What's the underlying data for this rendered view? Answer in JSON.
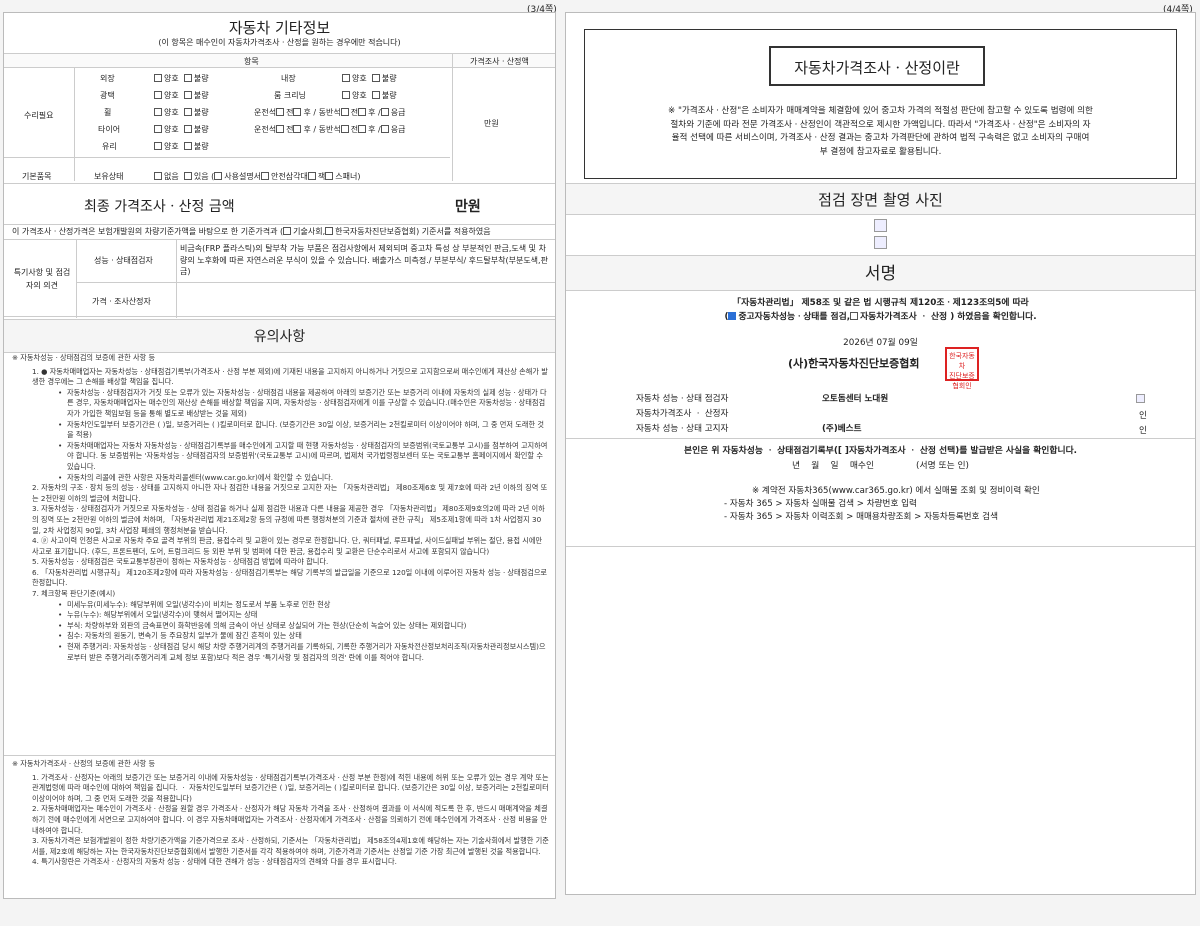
{
  "pages": {
    "left": "(3/4쪽)",
    "right": "(4/4쪽)"
  },
  "etc": {
    "title": "자동차 기타정보",
    "subtitle": "(이 항목은 매수인이 자동차가격조사ㆍ산정을 원하는 경우에만 적습니다)",
    "col_item": "항목",
    "col_price": "가격조사ㆍ산정액",
    "repair_label": "수리필요",
    "basic_label": "기본품목",
    "price_value": "만원",
    "opt_good": "양호",
    "opt_bad": "불량",
    "opt_none": "없음",
    "opt_have": "있음",
    "items": {
      "exterior": "외장",
      "interior": "내장",
      "gloss": "광택",
      "room": "룸 크리닝",
      "wheel": "휠",
      "tire": "타이어",
      "glass": "유리",
      "tool": "보유상태"
    },
    "driver": "운전석",
    "passenger": "동반석",
    "front": "전",
    "rear": "후",
    "spare": "응급",
    "basic_opts": {
      "manual": "사용설명서",
      "triangle": "안전삼각대",
      "jack": "잭",
      "spanner": "스패너"
    }
  },
  "final": {
    "label": "최종 가격조사ㆍ산정 금액",
    "unit": "만원",
    "note": "이 가격조사ㆍ산정가격은 보험개발원의 차량기준가액을 바탕으로 한 기준가격과 (",
    "opt1": "기술사회,",
    "opt2": "한국자동차진단보증협회) 기준서를 적용하였음"
  },
  "special": {
    "label": "특기사항 및 점검자의 의견",
    "inspector_label": "성능ㆍ상태점검자",
    "inspector_text": "비금속(FRP 플라스틱)의 탈부착 가능 부품은 점검사항에서 제외되며 중고차 특성 상 부분적인 판금,도색 및 차량의 노후화에 따른 자연스러운 부식이 있을 수 있습니다. 배출가스 미측정./ 부분부식/ 후드탈부착(부분도색,판금)",
    "appraiser_label": "가격ㆍ조사산정자"
  },
  "notes": {
    "title": "유의사항",
    "h1": "※ 자동차성능ㆍ상태점검의 보증에 관한 사항 등",
    "a1": "1.       ● 자동차매매업자는 자동차성능ㆍ상태점검기록부(가격조사ㆍ산정 부분 제외)에 기재된 내용을 고지하지 아니하거나 거짓으로 고지함으로써 매수인에게 재산상 손해가 발생한 경우에는 그 손해를 배상할 책임을 집니다.",
    "a2": "자동차성능ㆍ상태점검자가 거짓 또는 오류가 있는 자동차성능ㆍ상태점검 내용을 제공하여 아래의 보증기간 또는 보증거리 이내에 자동차의 실제 성능ㆍ상태가 다른 경우, 자동차매매업자는 매수인의 재산상 손해를 배상할 책임을 지며, 자동차성능ㆍ상태점검자에게 이를 구상할 수 있습니다.(매수인은 자동차성능ㆍ상태점검자가 가입한 책임보험 등을 통해 별도로 배상받는 것을 제외)",
    "a3": "자동차인도일부터 보증기간은 (        )일, 보증거리는 (        )킬로미터로 합니다. (보증기간은 30일 이상, 보증거리는 2천킬로미터 이상이어야 하며, 그 중 먼저 도래한 것을 적용)",
    "a4": "자동차매매업자는 자동차 자동차성능ㆍ상태점검기록부를 매수인에게 고지할 때 현행 자동차성능ㆍ상태점검자의 보증범위(국토교통부 고시)를 첨부하여 고지하여야 합니다. 동 보증범위는 '자동차성능ㆍ상태점검자의 보증범위'(국토교통부 고시)에 따르며, 법제처 국가법령정보센터 또는 국토교통부 홈페이지에서 확인할 수 있습니다.",
    "a5": "자동차의 리콜에 관한 사항은 자동차리콜센터(www.car.go.kr)에서 확인할 수 있습니다.",
    "n2": "2. 자동차의 구조ㆍ장치 등의 성능ㆍ상태를 고지하지 아니한 자나 점검한 내용을 거짓으로 고지한 자는 「자동차관리법」 제80조제6호 및 제7호에 따라 2년 이하의 징역 또는 2천만원 이하의 벌금에 처합니다.",
    "n3": "3. 자동차성능ㆍ상태점검자가 거짓으로 자동차성능ㆍ상태 점검을 하거나 실제 점검한 내용과 다른 내용을 제공한 경우 「자동차관리법」 제80조제9호의2에 따라 2년 이하의 징역 또는 2천만원 이하의 벌금에 처하며, 「자동차관리법 제21조제2항 등의 규정에 따른 행정처분의 기준과 절차에 관한 규칙」 제5조제1항에 따라 1차 사업정지 30일, 2차 사업정지 90일, 3차 사업장 폐쇄의 행정처분을 받습니다.",
    "n4": "4. ⓟ 사고이력 인정은 사고로 자동차 주요 골격 부위의 판금, 용접수리 및 교환이 있는 경우로 한정합니다. 단, 쿼터패널, 루프패널, 사이드실패널 부위는 절단, 용접 시에만 사고로 표기합니다. (후드, 프론트펜더, 도어, 트렁크리드 등 외판 부위 및 범퍼에 대한 판금, 용접수리 및 교환은 단순수리로서 사고에 포함되지 않습니다)",
    "n5": "5. 자동차성능ㆍ상태점검은 국토교통부장관이 정하는 자동차성능ㆍ상태점검 방법에 따라야 합니다.",
    "n6": "6. 「자동차관리법 시행규칙」 제120조제2항에 따라 자동차성능ㆍ상태점검기록부는 해당 기록부의 발급일을 기준으로 120일 이내에 이루어진 자동차 성능ㆍ상태점검으로 한정합니다.",
    "n7": "7. 체크항목 판단기준(예시)",
    "c1": "미세누유(미세누수): 해당부위에 오일(냉각수)이 비치는 정도로서 부품 노후로 인한 현상",
    "c2": "누유(누수): 해당부위에서 오일(냉각수)이 맺혀서 떨어지는 상태",
    "c3": "부식: 차량하부와 외판의 금속표면이 화학반응에 의해 금속이 아닌 상태로 상실되어 가는 현상(단순히 녹슬어 있는 상태는 제외합니다)",
    "c4": "침수: 자동차의 원동기, 변속기 등 주요장치 일부가 물에 잠긴 흔적이 있는 상태",
    "c5": "현재 주행거리: 자동차성능ㆍ상태점검 당시 해당 차량 주행거리계의 주행거리를 기록하되, 기록한 주행거리가 자동차전산정보처리조직(자동차관리정보시스템)으로부터 받은 주행거리(주행거리계 교체 정보 포함)보다 적은 경우 '특기사항 및 점검자의 의견' 란에 이를 적어야 합니다.",
    "h2": "※ 자동차가격조사ㆍ산정의 보증에 관한 사항 등",
    "p1": "1. 가격조사ㆍ산정자는 아래의 보증기간 또는 보증거리 이내에 자동차성능ㆍ상태점검기록부(가격조사ㆍ산정 부분 한정)에 적힌 내용에 허위 또는 오류가 있는 경우 계약 또는 관계법령에 따라 매수인에 대하여 책임을 집니다.   ㆍ 자동차인도일부터 보증기간은 (      )일, 보증거리는 (      )킬로미터로 합니다. (보증기간은 30일 이상, 보증거리는 2천킬로미터 이상이어야 하며, 그 중 먼저 도래한 것을 적용합니다)",
    "p2": "2. 자동차매매업자는 매수인이 가격조사ㆍ산정을 원할 경우 가격조사ㆍ산정자가 해당 자동차 가격을 조사ㆍ산정하여 결과를 이 서식에 적도록 한 후, 반드시 매매계약을 체결하기 전에 매수인에게 서면으로 고지하여야 합니다. 이 경우 자동차매매업자는 가격조사ㆍ산정자에게 가격조사ㆍ산정을 의뢰하기 전에 매수인에게 가격조사ㆍ산정 비용을 안내하여야 합니다.",
    "p3": "3. 자동차가격은 보험개발원이 정한 차량기준가액을 기준가격으로 조사ㆍ산정하되, 기준서는 「자동차관리법」 제58조의4제1호에 해당하는 자는 기술사회에서 발행한 기준서를, 제2호에 해당하는 자는 한국자동차진단보증협회에서 발행한 기준서를 각각 적용하여야 하며, 기준가격과 기준서는 산정일 기준 가장 최근에 발행된 것을 적용합니다.",
    "p4": "4. 특기사항란은 가격조사ㆍ산정자의 자동차 성능ㆍ상태에 대한 견해가 성능ㆍ상태점검자의 견해와 다를 경우 표시합니다."
  },
  "about": {
    "title": "자동차가격조사ㆍ산정이란",
    "t1": "※ \"가격조사ㆍ산정\"은 소비자가 매매계약을 체결함에 있어 중고차 가격의 적절성 판단에 참고할 수 있도록 법령에 의한",
    "t2": "절차와 기준에 따라 전문 가격조사ㆍ산정인이 객관적으로 제시한 가액입니다. 따라서 \"가격조사ㆍ산정\"은 소비자의 자",
    "t3": "율적 선택에 따른 서비스이며, 가격조사ㆍ산정 결과는 중고차 가격판단에 관하여 법적 구속력은 없고 소비자의 구매여",
    "t4": "부 결정에 참고자료로 활용됩니다."
  },
  "photos": {
    "title": "점검 장면 촬영 사진"
  },
  "sign": {
    "title": "서명",
    "law": "「자동차관리법」 제58조 및 같은 법 시행규칙 제120조ㆍ제123조의5에 따라",
    "check_a": "중고자동차성능ㆍ상태를 점검,",
    "check_b": "자동차가격조사 ㆍ 산정 ) 하였음을 확인합니다.",
    "date": "2026년 07월  09일",
    "org": "(사)한국자동차진단보증협회",
    "seal": "한국자동차진단보증협회인",
    "r1_label": "자동차 성능ㆍ상태 점검자",
    "r1_value": "오토돔센터 노대원",
    "r2_label": "자동차가격조사 ㆍ 산정자",
    "r3_label": "자동차 성능ㆍ상태 고지자",
    "r3_value": "(주)베스트",
    "in": "인",
    "confirm": "본인은 위 자동차성능 ㆍ 상태점검기록부([  ]자동차가격조사 ㆍ 산정 선택)를 발급받은 사실을 확인합니다.",
    "buyer": "년    월    일    매수인               (서명 또는 인)",
    "web1": "※ 계약전 자동차365(www.car365.go.kr) 에서 실매물 조회 및 정비이력 확인",
    "web2": "- 자동차 365 > 자동차 실매물 검색 > 차량번호 입력",
    "web3": "- 자동차 365 > 자동차 이력조회 > 매매용차량조회 > 자동차등록번호 검색"
  }
}
